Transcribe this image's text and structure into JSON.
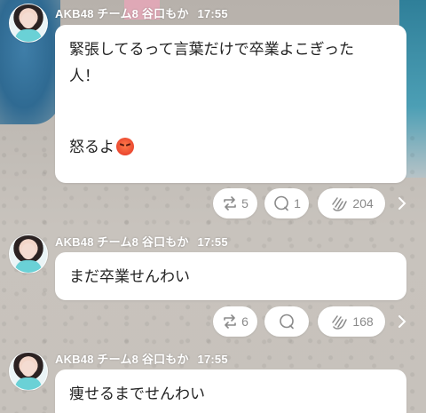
{
  "messages": [
    {
      "author": "AKB48 チーム8 谷口もか",
      "time": "17:55",
      "lines": [
        "緊張してるって言葉だけで卒業よこぎった",
        "人！",
        "",
        "怒るよ"
      ],
      "emoji": "angry-face-icon",
      "actions": {
        "repost": "5",
        "comment": "1",
        "clap": "204"
      }
    },
    {
      "author": "AKB48 チーム8 谷口もか",
      "time": "17:55",
      "lines": [
        "まだ卒業せんわい"
      ],
      "actions": {
        "repost": "6",
        "comment": "",
        "clap": "168"
      }
    },
    {
      "author": "AKB48 チーム8 谷口もか",
      "time": "17:55",
      "lines": [
        "痩せるまでせんわい"
      ]
    }
  ],
  "colors": {
    "bubble": "#ffffff",
    "icon": "#8a8a8a",
    "header_text": "#ffffff"
  }
}
